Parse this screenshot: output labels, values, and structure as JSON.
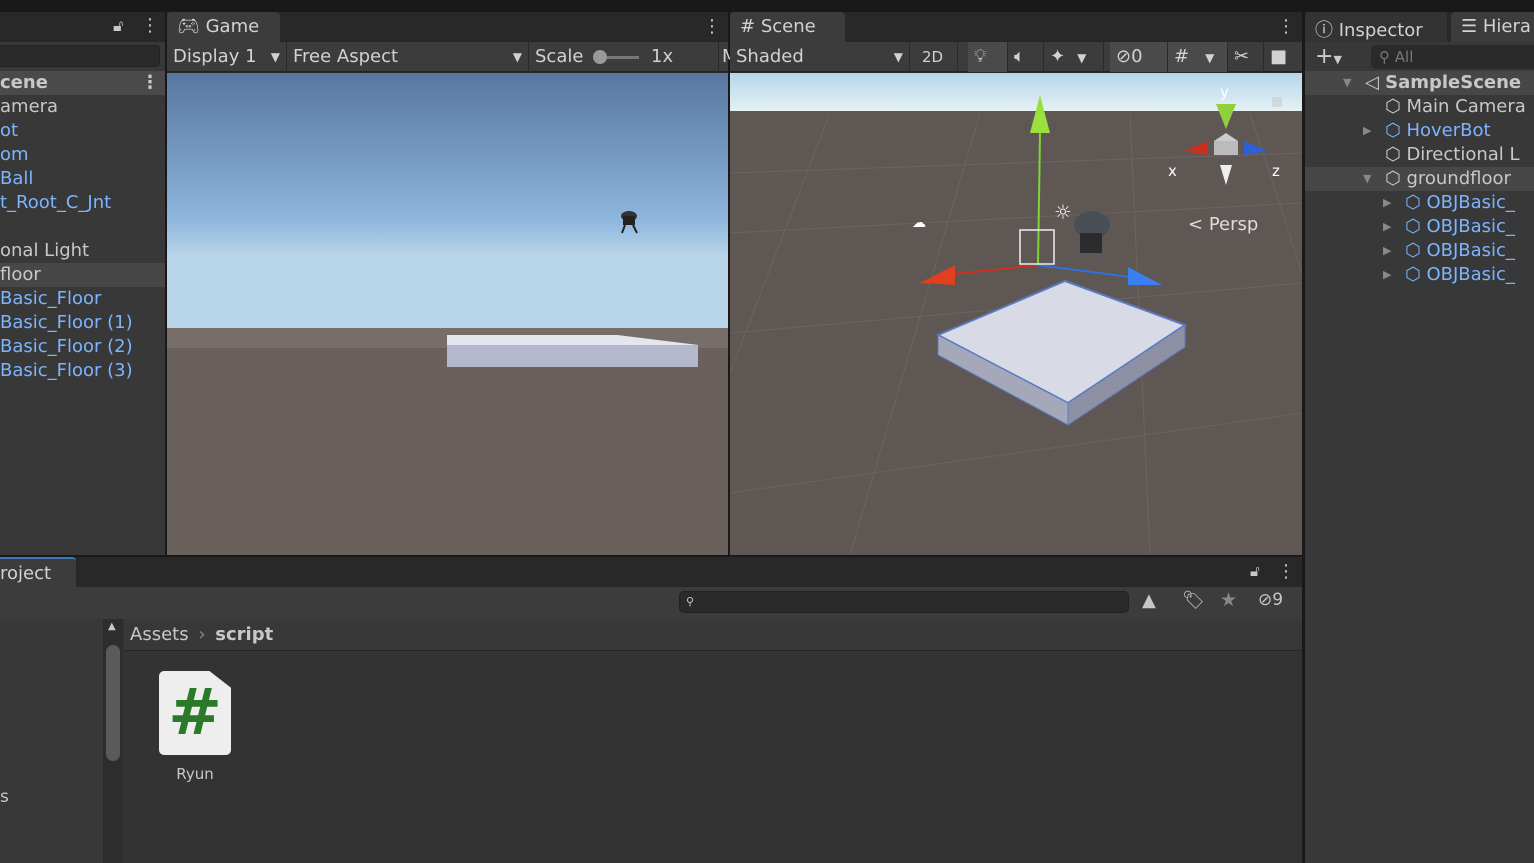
{
  "left_hierarchy": {
    "header": "cene",
    "items": [
      {
        "label": "amera",
        "prefab": false
      },
      {
        "label": "ot",
        "prefab": true
      },
      {
        "label": "om",
        "prefab": true
      },
      {
        "label": "Ball",
        "prefab": true
      },
      {
        "label": "t_Root_C_Jnt",
        "prefab": true
      },
      {
        "label": "",
        "prefab": false
      },
      {
        "label": "onal Light",
        "prefab": false
      },
      {
        "label": "floor",
        "prefab": false,
        "selected": true
      },
      {
        "label": "Basic_Floor",
        "prefab": true
      },
      {
        "label": "Basic_Floor (1)",
        "prefab": true
      },
      {
        "label": "Basic_Floor (2)",
        "prefab": true
      },
      {
        "label": "Basic_Floor (3)",
        "prefab": true
      }
    ]
  },
  "game": {
    "tab": "Game",
    "display": "Display 1",
    "aspect": "Free Aspect",
    "scale_label": "Scale",
    "scale_value": "1x",
    "cut_label": "M"
  },
  "scene": {
    "tab": "Scene",
    "shading": "Shaded",
    "mode_2d": "2D",
    "hidden_count": "0",
    "persp": "Persp",
    "axis_x": "x",
    "axis_y": "y",
    "axis_z": "z"
  },
  "right": {
    "tab_inspector": "Inspector",
    "tab_hierarchy": "Hiera",
    "search_placeholder": "All",
    "items": [
      {
        "label": "SampleScene",
        "type": "scene"
      },
      {
        "label": "Main Camera",
        "type": "object"
      },
      {
        "label": "HoverBot",
        "type": "prefab"
      },
      {
        "label": "Directional L",
        "type": "object"
      },
      {
        "label": "groundfloor",
        "type": "object",
        "selected": true
      },
      {
        "label": "OBJBasic_",
        "type": "prefab"
      },
      {
        "label": "OBJBasic_",
        "type": "prefab"
      },
      {
        "label": "OBJBasic_",
        "type": "prefab"
      },
      {
        "label": "OBJBasic_",
        "type": "prefab"
      }
    ]
  },
  "project": {
    "tab": "roject",
    "hidden_count": "9",
    "breadcrumb_root": "Assets",
    "breadcrumb_current": "script",
    "assets": [
      {
        "name": "Ryun",
        "type": "csharp-script"
      }
    ],
    "left_cut_text": "s"
  },
  "colors": {
    "prefab": "#7cb4ff",
    "accent": "#3a79bb",
    "script_icon": "#2a7a2a"
  }
}
